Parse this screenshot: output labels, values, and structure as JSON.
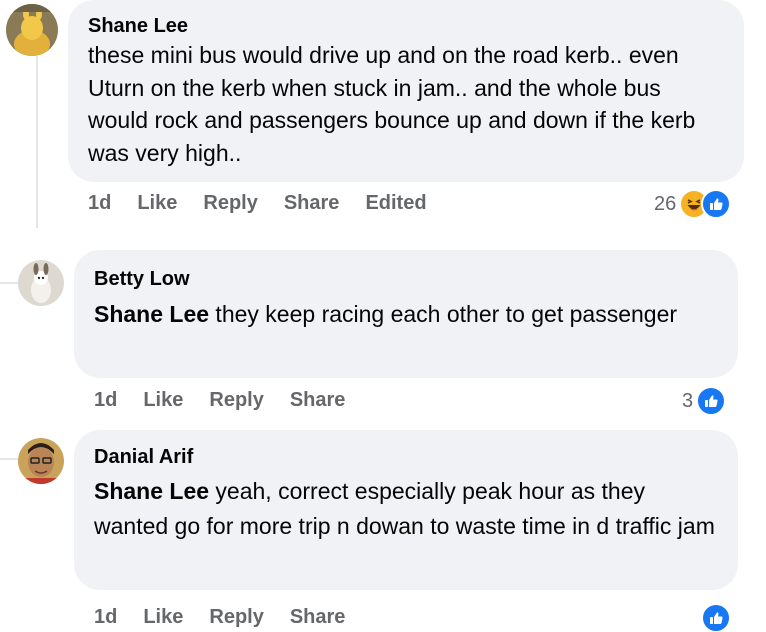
{
  "comments": [
    {
      "author": "Shane Lee",
      "mention": "",
      "text": "these mini bus would drive up and on the road kerb.. even Uturn on the kerb when stuck in jam.. and the whole bus would rock and passengers bounce up and down if the kerb was very high..",
      "time": "1d",
      "like": "Like",
      "reply": "Reply",
      "share": "Share",
      "edited": "Edited",
      "reaction_count": "26",
      "reactions": [
        "haha-icon",
        "like-icon"
      ]
    },
    {
      "author": "Betty Low",
      "mention": "Shane Lee",
      "text": " they keep racing each other to get passenger",
      "time": "1d",
      "like": "Like",
      "reply": "Reply",
      "share": "Share",
      "reaction_count": "3",
      "reactions": [
        "like-icon"
      ]
    },
    {
      "author": "Danial Arif",
      "mention": "Shane Lee",
      "text": " yeah, correct especially peak hour as they wanted go for more trip n dowan to waste time in d traffic jam",
      "time": "1d",
      "like": "Like",
      "reply": "Reply",
      "share": "Share",
      "reaction_count": "",
      "reactions": [
        "like-icon"
      ]
    }
  ],
  "colors": {
    "bubble": "#f0f2f5",
    "meta_text": "#65676b",
    "like_blue": "#1877f2",
    "haha_yellow": "#f7b125"
  }
}
